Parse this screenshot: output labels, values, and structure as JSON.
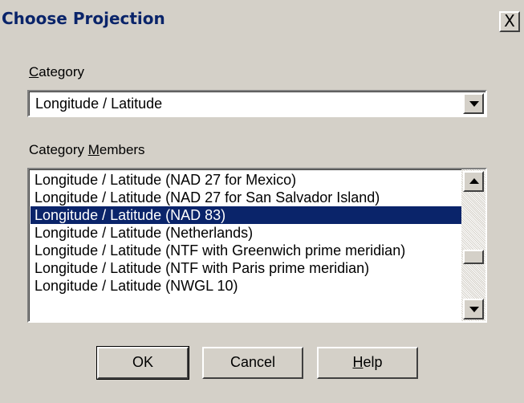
{
  "window": {
    "title": "Choose Projection",
    "close_glyph": "X"
  },
  "category": {
    "label_prefix": "",
    "label_accel": "C",
    "label_rest": "ategory",
    "selected_value": "Longitude / Latitude"
  },
  "members": {
    "label_prefix": "Category ",
    "label_accel": "M",
    "label_rest": "embers",
    "items": [
      "Longitude / Latitude (NAD 27 for Mexico)",
      "Longitude / Latitude (NAD 27 for San Salvador Island)",
      "Longitude / Latitude (NAD 83)",
      "Longitude / Latitude (Netherlands)",
      "Longitude / Latitude (NTF with Greenwich prime meridian)",
      "Longitude / Latitude (NTF with Paris prime meridian)",
      "Longitude / Latitude (NWGL 10)"
    ],
    "selected_index": 2
  },
  "buttons": {
    "ok": "OK",
    "cancel": "Cancel",
    "help_accel": "H",
    "help_rest": "elp"
  },
  "colors": {
    "face": "#d4d0c8",
    "selection": "#0a246a",
    "title_text": "#0a246a"
  },
  "icons": {
    "close": "close-icon",
    "dropdown": "chevron-down-icon",
    "scroll_up": "scroll-up-icon",
    "scroll_down": "scroll-down-icon"
  }
}
